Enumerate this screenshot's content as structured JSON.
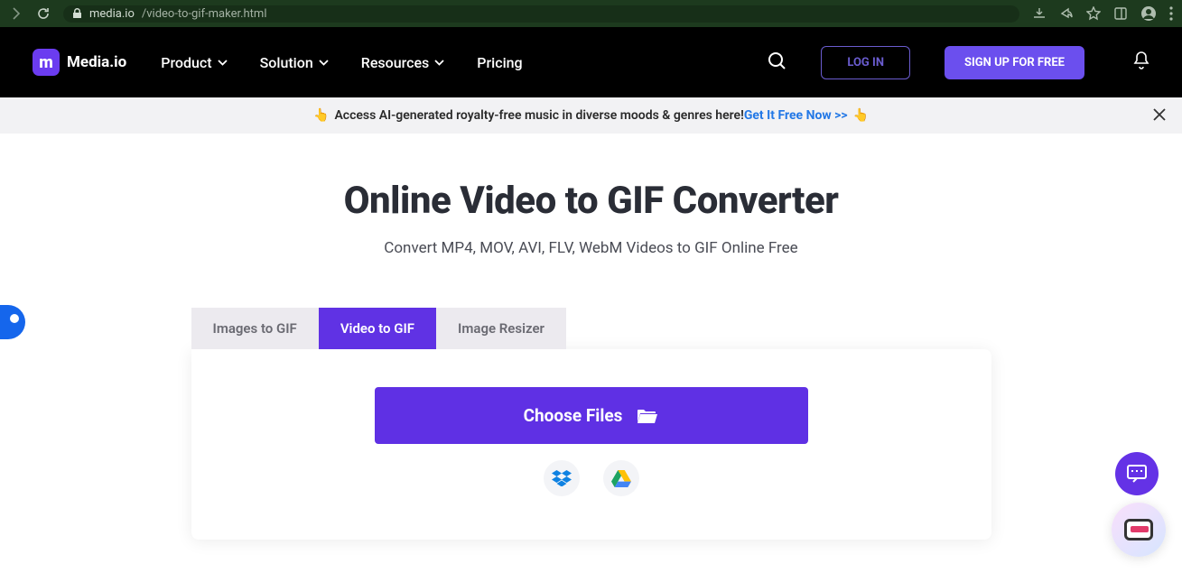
{
  "browser": {
    "url_host": "media.io",
    "url_path": "/video-to-gif-maker.html"
  },
  "header": {
    "brand": "Media.io",
    "nav": {
      "product": "Product",
      "solution": "Solution",
      "resources": "Resources",
      "pricing": "Pricing"
    },
    "login": "LOG IN",
    "signup": "SIGN UP FOR FREE"
  },
  "promo": {
    "text": "Access AI-generated royalty-free music in diverse moods & genres here! ",
    "cta": "Get It Free Now >>"
  },
  "page": {
    "title": "Online Video to GIF Converter",
    "subtitle": "Convert MP4, MOV, AVI, FLV, WebM Videos to GIF Online Free"
  },
  "tabs": {
    "images": "Images to GIF",
    "video": "Video to GIF",
    "resizer": "Image Resizer",
    "active": "video"
  },
  "upload": {
    "choose": "Choose Files"
  }
}
